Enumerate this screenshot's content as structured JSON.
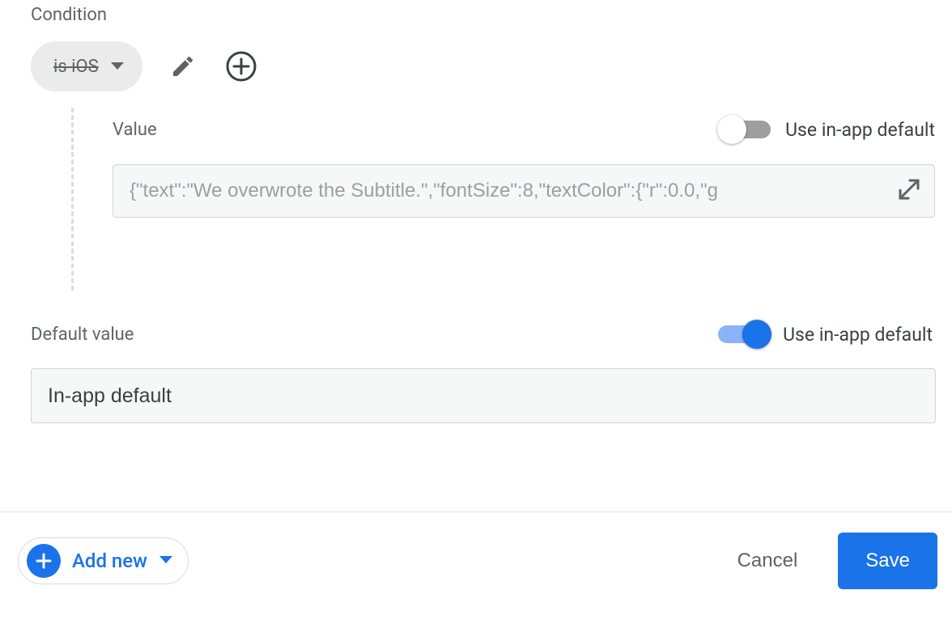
{
  "condition": {
    "label": "Condition",
    "chip_text": "is iOS"
  },
  "value": {
    "label": "Value",
    "toggle_label": "Use in-app default",
    "toggle_on": false,
    "input_value": "{\"text\":\"We overwrote the Subtitle.\",\"fontSize\":8,\"textColor\":{\"r\":0.0,\"g"
  },
  "default_value": {
    "label": "Default value",
    "toggle_label": "Use in-app default",
    "toggle_on": true,
    "input_value": "In-app default"
  },
  "footer": {
    "add_new_label": "Add new",
    "cancel_label": "Cancel",
    "save_label": "Save"
  },
  "colors": {
    "primary": "#1a73e8",
    "muted_text": "#5f6368",
    "border": "#dadce0"
  }
}
